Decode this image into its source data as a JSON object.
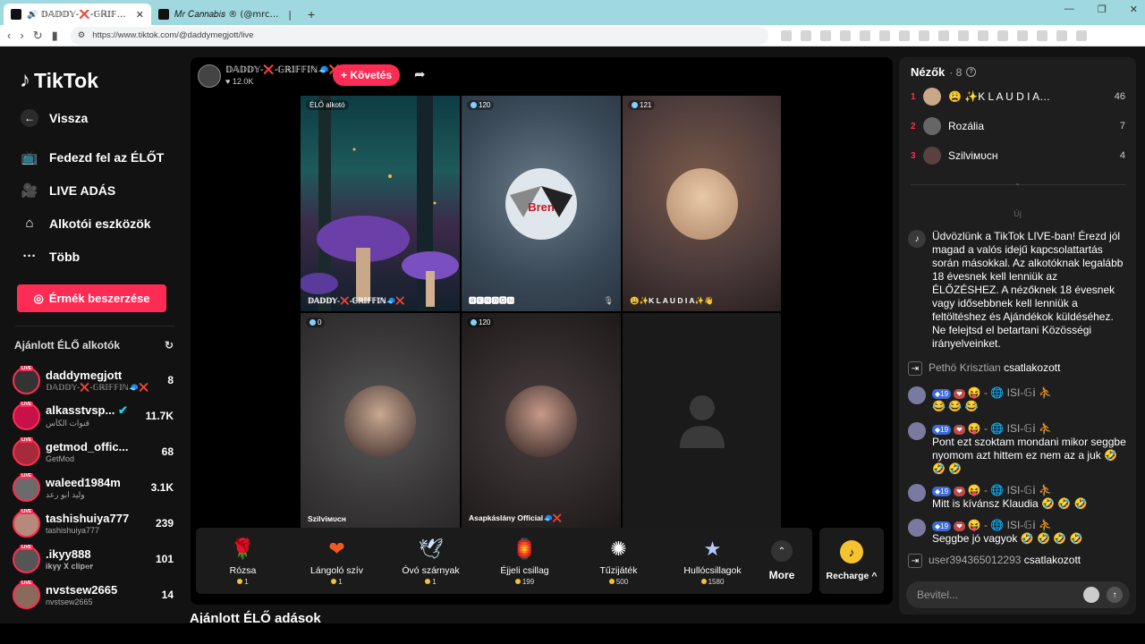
{
  "browser": {
    "tabs": [
      {
        "title": "🔊 𝔻𝔸𝔻𝔻𝕐-❌-𝔾ℝ𝕀𝔽𝔽𝕀ℕ🧢❌ (@da",
        "active": true
      },
      {
        "title": "𝑀𝑟 𝐶𝑎𝑛𝑛𝑎𝑏𝑖𝑠 ® (@mrcannabis_)",
        "active": false
      }
    ],
    "url": "https://www.tiktok.com/@daddymegjott/live"
  },
  "sidebar": {
    "logo": "TikTok",
    "back": "Vissza",
    "menu": [
      {
        "label": "Fedezd fel az ÉLŐT",
        "icon": "tv-icon"
      },
      {
        "label": "LIVE ADÁS",
        "icon": "camera-icon"
      },
      {
        "label": "Alkotói eszközök",
        "icon": "creator-tools-icon"
      },
      {
        "label": "Több",
        "icon": "more-icon"
      }
    ],
    "coins_button": "Érmék beszerzése",
    "recommended_title": "Ajánlott ÉLŐ alkotók",
    "creators": [
      {
        "name": "daddymegjott",
        "sub": "𝔻𝔸𝔻𝔻𝕐-❌-𝔾ℝ𝕀𝔽𝔽𝕀ℕ🧢❌",
        "count": "8"
      },
      {
        "name": "alkasstvsp...",
        "sub": "قنوات الكأس",
        "count": "11.7K"
      },
      {
        "name": "getmod_offic...",
        "sub": "GetMod",
        "count": "68"
      },
      {
        "name": "waleed1984m",
        "sub": "وليد ابو رعد",
        "count": "3.1K"
      },
      {
        "name": "tashishuiya777",
        "sub": "tashishuiya777",
        "count": "239"
      },
      {
        "name": ".ikyy888",
        "sub": "𝐢𝐤𝐲𝐲 𝐗 𝐜𝐥𝐢𝐩𝐞𝐫",
        "count": "101"
      },
      {
        "name": "nvstsew2665",
        "sub": "nvstsew2665",
        "count": "14"
      }
    ]
  },
  "stream": {
    "host_name": "𝔻𝔸𝔻𝔻𝕐-❌-𝔾ℝ𝕀𝔽𝔽𝕀ℕ🧢❌",
    "host_likes": "♥ 12.0K",
    "follow_label": "+ Követés",
    "cells": [
      {
        "badge": "ÉLŐ alkotó",
        "name": "𝔻𝔸𝔻𝔻𝕐-❌-𝔾ℝ𝕀𝔽𝔽𝕀ℕ🧢❌"
      },
      {
        "badge": "120",
        "name": "🅱🅴🅽🅳🅾🅽"
      },
      {
        "badge": "121",
        "name": "😩✨K L A U D I A✨👋"
      },
      {
        "badge": "0",
        "name": "Szilviᴍᴜᴄʜ"
      },
      {
        "badge": "120",
        "name": "Asapkáslány Official🧢❌"
      },
      {
        "badge": "",
        "name": ""
      }
    ],
    "gifts": [
      {
        "name": "Rózsa",
        "price": "1",
        "icon": "rose-icon"
      },
      {
        "name": "Lángoló szív",
        "price": "1",
        "icon": "heart-icon"
      },
      {
        "name": "Óvó szárnyak",
        "price": "1",
        "icon": "wings-icon"
      },
      {
        "name": "Éjjeli csillag",
        "price": "199",
        "icon": "lantern-icon"
      },
      {
        "name": "Tűzijáték",
        "price": "500",
        "icon": "firework-icon"
      },
      {
        "name": "Hullócsillagok",
        "price": "1580",
        "icon": "star-icon"
      }
    ],
    "more_label": "More",
    "recharge_label": "Recharge ^",
    "recommended_lives": "Ajánlott ÉLŐ adások"
  },
  "chat": {
    "viewers_title": "Nézők",
    "viewers_count": "· 8",
    "viewers": [
      {
        "rank": "1",
        "name": "😩 ✨K L A U D I A…",
        "score": "46"
      },
      {
        "rank": "2",
        "name": "Rozália",
        "score": "7"
      },
      {
        "rank": "3",
        "name": "Szilviᴍᴜᴄʜ",
        "score": "4"
      }
    ],
    "new_label": "Új",
    "welcome": "Üdvözlünk a TikTok LIVE-ban! Érezd jól magad a valós idejű kapcsolattartás során másokkal. Az alkotóknak legalább 18 évesnek kell lenniük az ÉLŐZÉSHEZ. A nézőknek 18 évesnek vagy idősebbnek kell lenniük a feltöltéshez és Ajándékok küldéséhez. Ne felejtsd el betartani Közösségi irányelveinket.",
    "joined1_user": "Pethö Krisztian",
    "joined_label": "csatlakozott",
    "level": "19",
    "isi_name": "😝 - 🌐 ISI-𝔾𝕚",
    "msgs": [
      "😂 😂 😂",
      "Pont ezt szoktam mondani mikor seggbe nyomom azt hittem ez nem az a juk 🤣 🤣 🤣",
      "Mitt is kívánsz Klaudia 🤣 🤣 🤣",
      "Seggbe jó vagyok 🤣 🤣 🤣 🤣"
    ],
    "joined2_user": "user394365012293",
    "input_placeholder": "Bevitel..."
  }
}
